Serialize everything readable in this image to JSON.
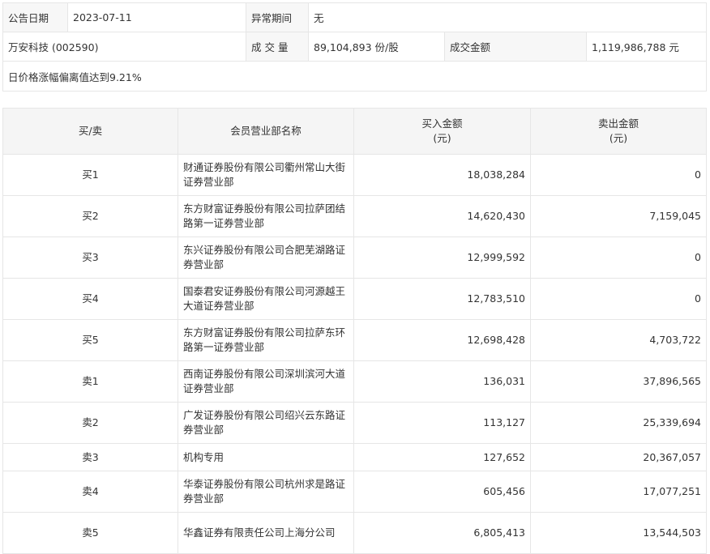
{
  "info": {
    "date_label": "公告日期",
    "date": "2023-07-11",
    "period_label": "异常期间",
    "period": "无",
    "stock": "万安科技 (002590)",
    "volume_label": "成 交 量",
    "volume": "89,104,893 份/股",
    "amount_label": "成交金额",
    "amount": "1,119,986,788 元",
    "reason": "日价格涨幅偏离值达到9.21%"
  },
  "table": {
    "headers": [
      "买/卖",
      "会员营业部名称",
      "买入金额\n(元)",
      "卖出金额\n(元)"
    ],
    "header_buy": [
      "买入金额",
      "(元)"
    ],
    "header_sell": [
      "卖出金额",
      "(元)"
    ],
    "rows": [
      {
        "side": "买1",
        "name": "财通证券股份有限公司衢州常山大街证券营业部",
        "buy": "18,038,284",
        "sell": "0"
      },
      {
        "side": "买2",
        "name": "东方财富证券股份有限公司拉萨团结路第一证券营业部",
        "buy": "14,620,430",
        "sell": "7,159,045"
      },
      {
        "side": "买3",
        "name": "东兴证券股份有限公司合肥芜湖路证券营业部",
        "buy": "12,999,592",
        "sell": "0"
      },
      {
        "side": "买4",
        "name": "国泰君安证券股份有限公司河源越王大道证券营业部",
        "buy": "12,783,510",
        "sell": "0"
      },
      {
        "side": "买5",
        "name": "东方财富证券股份有限公司拉萨东环路第一证券营业部",
        "buy": "12,698,428",
        "sell": "4,703,722"
      },
      {
        "side": "卖1",
        "name": "西南证券股份有限公司深圳滨河大道证券营业部",
        "buy": "136,031",
        "sell": "37,896,565"
      },
      {
        "side": "卖2",
        "name": "广发证券股份有限公司绍兴云东路证券营业部",
        "buy": "113,127",
        "sell": "25,339,694"
      },
      {
        "side": "卖3",
        "name": "机构专用",
        "buy": "127,652",
        "sell": "20,367,057"
      },
      {
        "side": "卖4",
        "name": "华泰证券股份有限公司杭州求是路证券营业部",
        "buy": "605,456",
        "sell": "17,077,251"
      },
      {
        "side": "卖5",
        "name": "华鑫证券有限责任公司上海分公司",
        "buy": "6,805,413",
        "sell": "13,544,503"
      }
    ]
  }
}
